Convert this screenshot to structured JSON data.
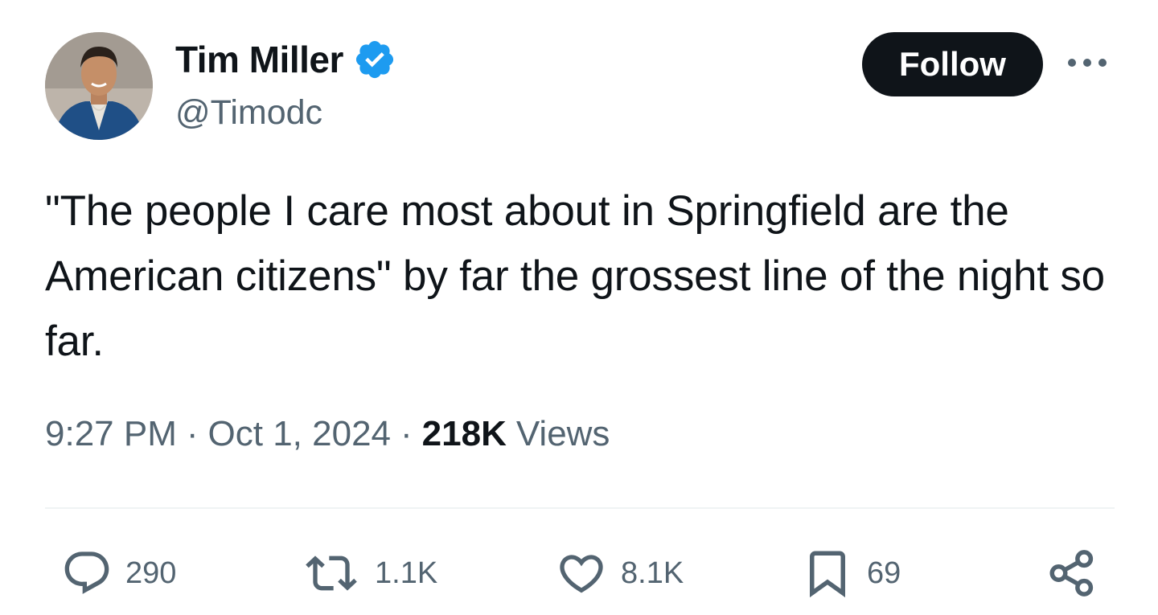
{
  "author": {
    "display_name": "Tim Miller",
    "handle": "@Timodc",
    "verified": true,
    "verified_color": "#1d9bf0"
  },
  "header": {
    "follow_label": "Follow",
    "more_icon": "ellipsis-icon"
  },
  "tweet": {
    "text": "\"The people I care most about in Springfield are the American citizens\" by far the grossest line of the night so far."
  },
  "meta": {
    "time": "9:27 PM",
    "separator": "·",
    "date": "Oct 1, 2024",
    "views_count": "218K",
    "views_label": "Views"
  },
  "actions": [
    {
      "icon": "reply-icon",
      "count": "290"
    },
    {
      "icon": "retweet-icon",
      "count": "1.1K"
    },
    {
      "icon": "like-icon",
      "count": "8.1K"
    },
    {
      "icon": "bookmark-icon",
      "count": "69"
    },
    {
      "icon": "share-icon",
      "count": ""
    }
  ],
  "colors": {
    "text_primary": "#0f1419",
    "text_secondary": "#536471",
    "divider": "#eff3f4",
    "follow_bg": "#0f1419"
  }
}
